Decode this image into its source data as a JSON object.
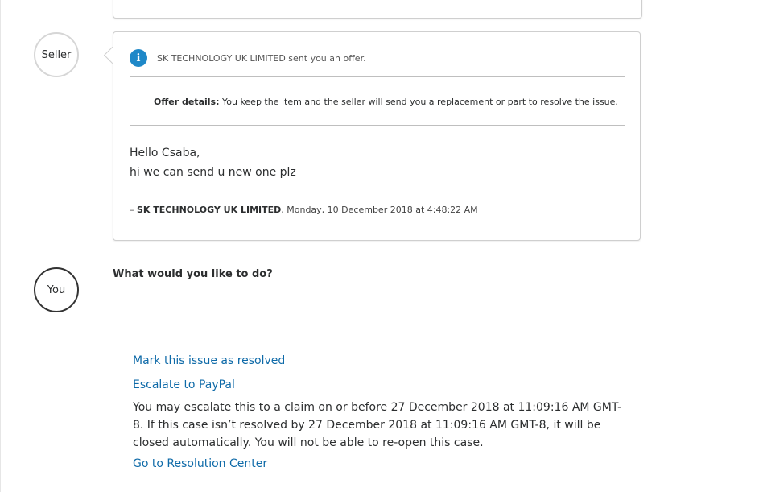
{
  "timeline": {
    "seller_label": "Seller",
    "you_label": "You"
  },
  "offer": {
    "info_icon": "info-icon",
    "notice": "SK TECHNOLOGY UK LIMITED sent you an offer.",
    "details_label": "Offer details:",
    "details_text": " You keep the item and the seller will send you a replacement or part to resolve the issue.",
    "message_lines": [
      "Hello Csaba,",
      "hi we can send u new one plz"
    ],
    "signature_prefix": "– ",
    "signature_name": "SK TECHNOLOGY UK LIMITED",
    "signature_date": ", Monday, 10 December 2018 at 4:48:22 AM"
  },
  "actions": {
    "question": "What would you like to do?",
    "mark_resolved": "Mark this issue as resolved",
    "escalate": "Escalate to PayPal",
    "escalate_note": "You may escalate this to a claim on or before 27 December 2018 at 11:09:16 AM GMT-8. If this case isn’t resolved by 27 December 2018 at 11:09:16 AM GMT-8, it will be closed automatically. You will not be able to re-open this case.",
    "resolution_center": "Go to Resolution Center"
  },
  "colors": {
    "link": "#0e6aa8",
    "info_icon_bg": "#1e88c8"
  }
}
